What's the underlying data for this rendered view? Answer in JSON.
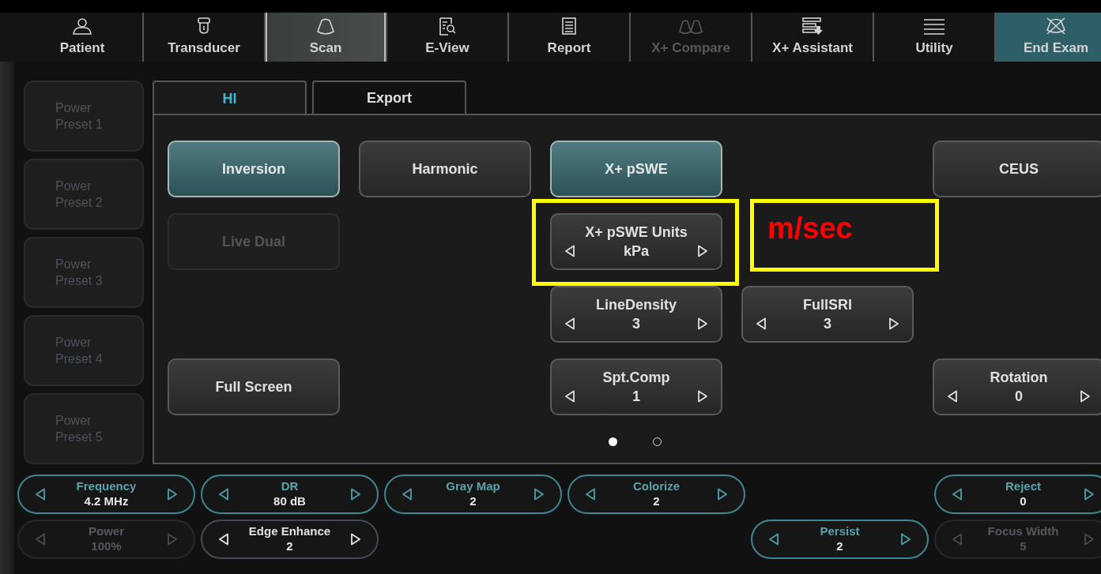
{
  "nav": [
    {
      "label": "Patient",
      "selected": false,
      "disabled": false,
      "highlighted": false
    },
    {
      "label": "Transducer",
      "selected": false,
      "disabled": false,
      "highlighted": false
    },
    {
      "label": "Scan",
      "selected": true,
      "disabled": false,
      "highlighted": false
    },
    {
      "label": "E-View",
      "selected": false,
      "disabled": false,
      "highlighted": false
    },
    {
      "label": "Report",
      "selected": false,
      "disabled": false,
      "highlighted": false
    },
    {
      "label": "X+ Compare",
      "selected": false,
      "disabled": true,
      "highlighted": false
    },
    {
      "label": "X+ Assistant",
      "selected": false,
      "disabled": false,
      "highlighted": false
    },
    {
      "label": "Utility",
      "selected": false,
      "disabled": false,
      "highlighted": false
    },
    {
      "label": "End Exam",
      "selected": false,
      "disabled": false,
      "highlighted": true
    }
  ],
  "presets": [
    {
      "label": "Power Preset 1",
      "disabled": true
    },
    {
      "label": "Power Preset 2",
      "disabled": true
    },
    {
      "label": "Power Preset 3",
      "disabled": true
    },
    {
      "label": "Power Preset 4",
      "disabled": true
    },
    {
      "label": "Power Preset 5",
      "disabled": true
    }
  ],
  "tabs": [
    {
      "label": "HI",
      "selected": true
    },
    {
      "label": "Export",
      "selected": false
    }
  ],
  "panel_rows": [
    [
      {
        "kind": "button",
        "label": "Inversion",
        "on": true,
        "disabled": false
      },
      {
        "kind": "button",
        "label": "Harmonic",
        "on": false,
        "disabled": false
      },
      {
        "kind": "button",
        "label": "X+ pSWE",
        "on": true,
        "disabled": false
      },
      null,
      {
        "kind": "button",
        "label": "CEUS",
        "on": false,
        "disabled": false
      }
    ],
    [
      {
        "kind": "button",
        "label": "Live Dual",
        "on": false,
        "disabled": true
      },
      null,
      {
        "kind": "spinner",
        "label": "X+ pSWE Units",
        "value": "kPa",
        "framed": true
      },
      {
        "kind": "note",
        "text": "m/sec",
        "framed": true
      },
      null
    ],
    [
      null,
      null,
      {
        "kind": "spinner",
        "label": "LineDensity",
        "value": "3",
        "framed": false
      },
      {
        "kind": "spinner",
        "label": "FullSRI",
        "value": "3",
        "framed": false
      },
      null
    ],
    [
      {
        "kind": "button",
        "label": "Full Screen",
        "on": false,
        "disabled": false
      },
      null,
      {
        "kind": "spinner",
        "label": "Spt.Comp",
        "value": "1",
        "framed": false
      },
      null,
      {
        "kind": "spinner",
        "label": "Rotation",
        "value": "0",
        "framed": false
      }
    ]
  ],
  "pages": [
    {
      "selected": true
    },
    {
      "selected": false
    }
  ],
  "bottom_rows": [
    [
      {
        "label": "Frequency",
        "value": "4.2 MHz",
        "highlighted": true,
        "disabled": false
      },
      {
        "label": "DR",
        "value": "80 dB",
        "highlighted": true,
        "disabled": false
      },
      {
        "label": "Gray Map",
        "value": "2",
        "highlighted": true,
        "disabled": false
      },
      {
        "label": "Colorize",
        "value": "2",
        "highlighted": true,
        "disabled": false
      },
      null,
      {
        "label": "Reject",
        "value": "0",
        "highlighted": true,
        "disabled": false
      }
    ],
    [
      {
        "label": "Power",
        "value": "100%",
        "highlighted": false,
        "disabled": true
      },
      {
        "label": "Edge Enhance",
        "value": "2",
        "highlighted": false,
        "disabled": false
      },
      null,
      null,
      {
        "label": "Persist",
        "value": "2",
        "highlighted": true,
        "disabled": false
      },
      {
        "label": "Focus Width",
        "value": "5",
        "highlighted": false,
        "disabled": true
      }
    ]
  ]
}
